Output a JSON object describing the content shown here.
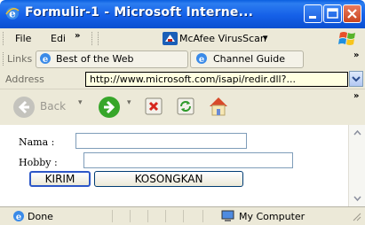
{
  "window": {
    "title": "Formulir-1 - Microsoft Interne...",
    "controls": [
      "minimize",
      "maximize",
      "close"
    ]
  },
  "menubar": {
    "items": [
      "File",
      "Edi"
    ],
    "overflow": "»",
    "plugin": {
      "label": "McAfee VirusScan",
      "arrow": "▾"
    }
  },
  "linksbar": {
    "label": "Links",
    "links": [
      "Best of the Web",
      "Channel Guide"
    ],
    "overflow": "»"
  },
  "addressbar": {
    "label": "Address",
    "tooltip": "http://www.microsoft.com/isapi/redir.dll?..."
  },
  "navbar": {
    "back_label": "Back",
    "overflow": "»"
  },
  "form": {
    "nama_label": "Nama :",
    "nama_value": "",
    "hobby_label": "Hobby :",
    "hobby_value": "",
    "submit_label": "KIRIM",
    "reset_label": "KOSONGKAN"
  },
  "statusbar": {
    "status": "Done",
    "zone": "My Computer"
  },
  "colors": {
    "titlebar": "#0a5fe0",
    "chrome": "#ece9d8",
    "tooltip_bg": "#ffffe1",
    "close_button": "#c9451f"
  }
}
